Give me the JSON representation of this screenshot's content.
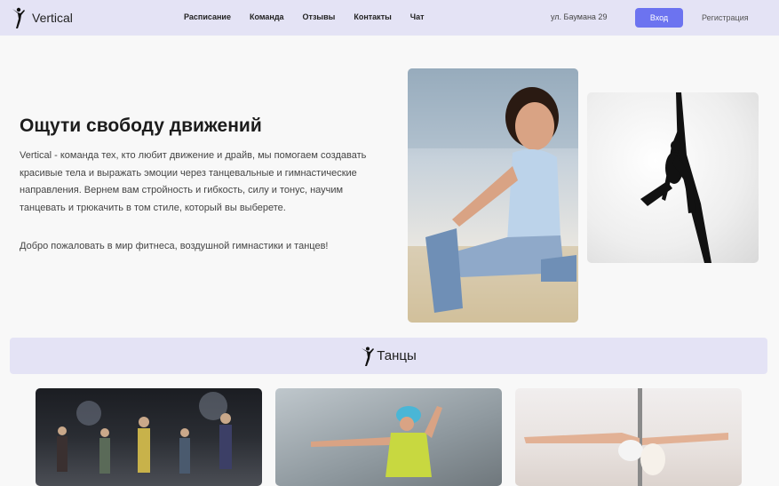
{
  "header": {
    "logo_text": "Vertical",
    "nav": [
      "Расписание",
      "Команда",
      "Отзывы",
      "Контакты",
      "Чат"
    ],
    "address": "ул. Баумана 29",
    "login_label": "Вход",
    "register_label": "Регистрация"
  },
  "hero": {
    "title": "Ощути свободу движений",
    "text": "Vertical - команда тех, кто любит движение и драйв, мы помогаем создавать красивые тела и выражать эмоции через танцевальные и гимнастические направления. Вернем вам стройность и гибкость, силу и тонус, научим танцевать и трюкачить в том стиле, который вы выберете.",
    "welcome": "Добро пожаловать в мир фитнеса, воздушной гимнастики и танцев!"
  },
  "section": {
    "title": "Танцы"
  },
  "colors": {
    "header_bg": "#e4e3f5",
    "accent": "#6c73f0"
  }
}
